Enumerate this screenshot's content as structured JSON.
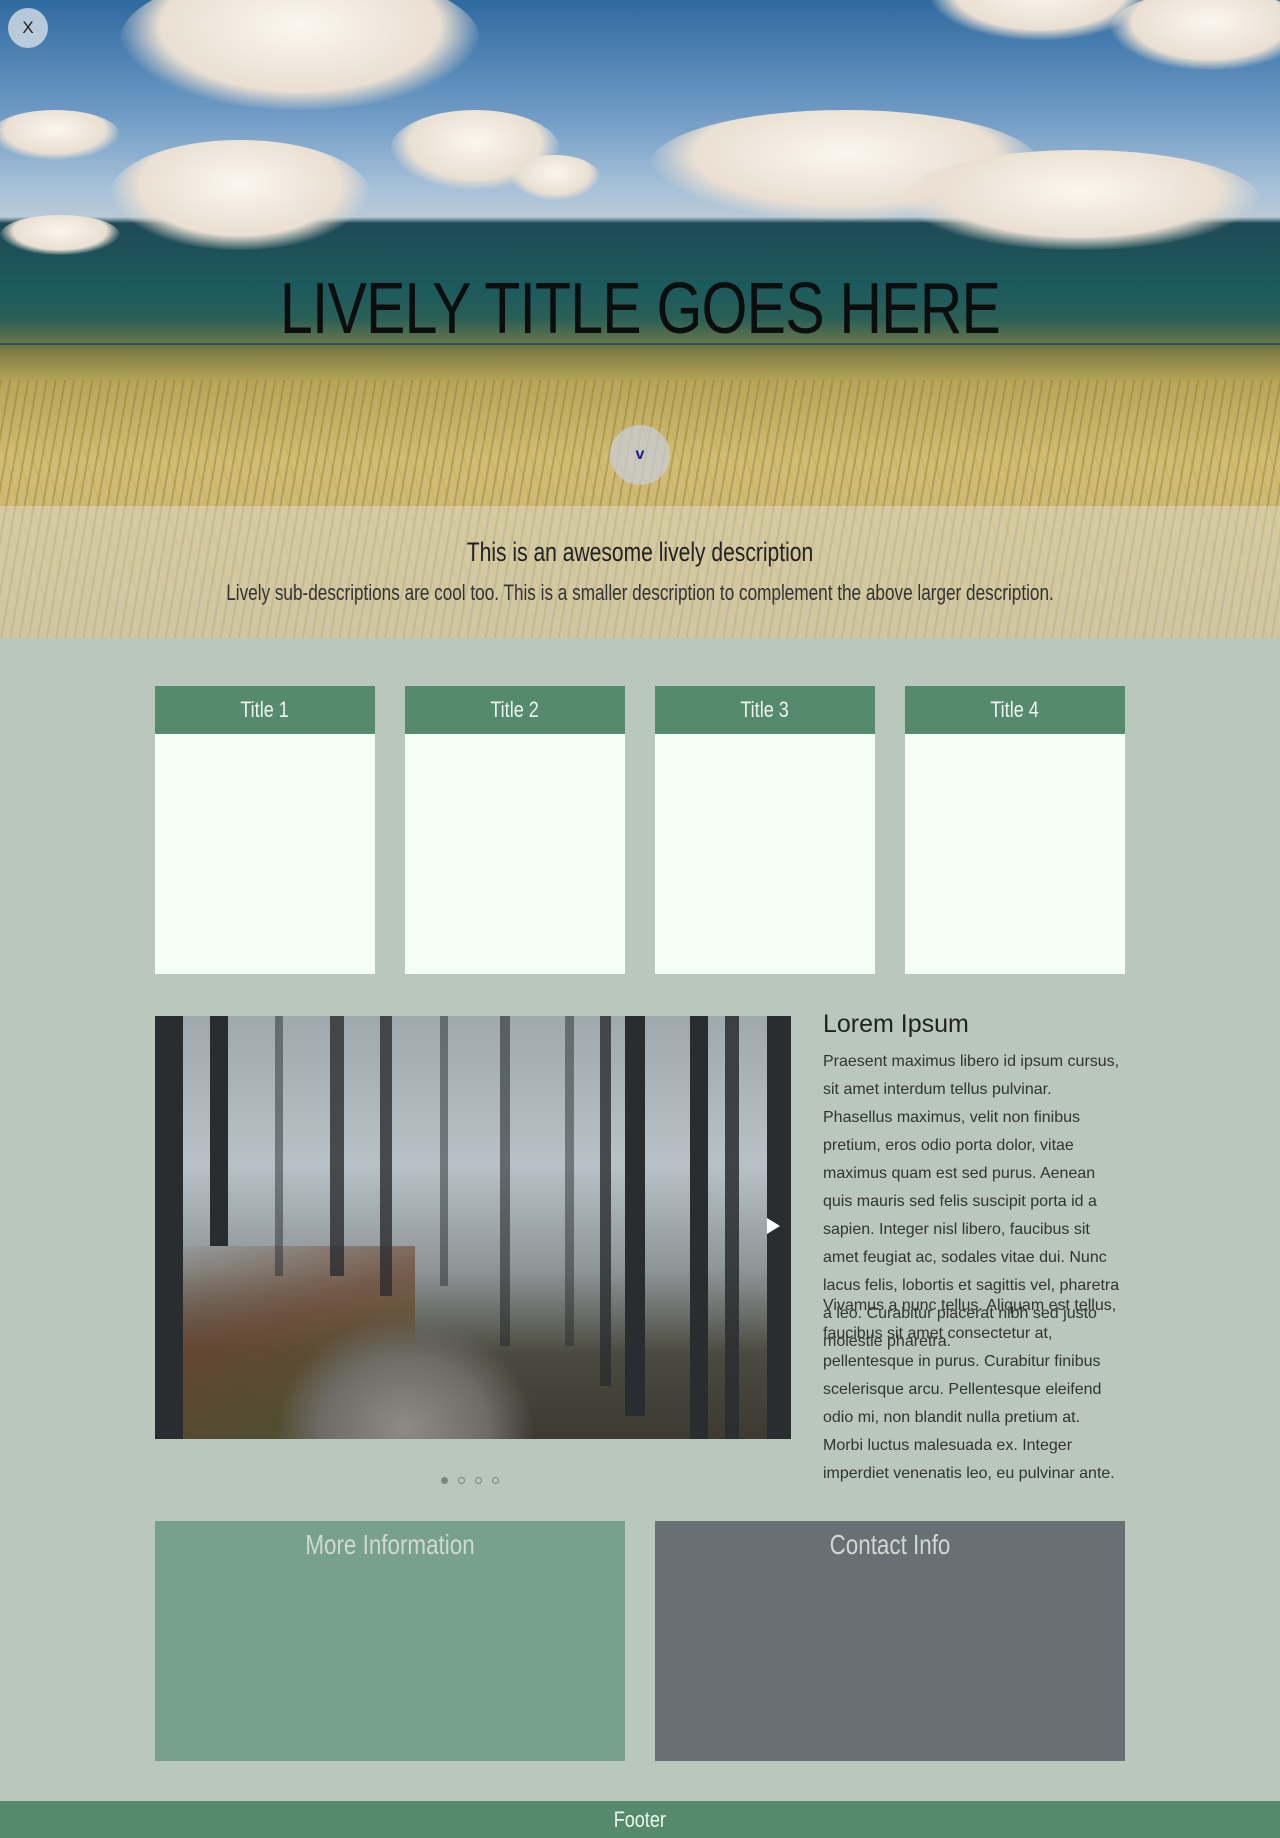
{
  "hero": {
    "close_label": "X",
    "title": "LIVELY TITLE GOES HERE",
    "scroll_label": "v",
    "description": "This is an awesome lively description",
    "sub_description": "Lively sub-descriptions are cool too. This is a smaller description to complement the above larger description."
  },
  "cards": [
    {
      "title": "Title 1"
    },
    {
      "title": "Title 2"
    },
    {
      "title": "Title 3"
    },
    {
      "title": "Title 4"
    }
  ],
  "article": {
    "title": "Lorem Ipsum",
    "paragraph1": "Praesent maximus libero id ipsum cursus, sit amet interdum tellus pulvinar. Phasellus maximus, velit non finibus pretium, eros odio porta dolor, vitae maximus quam est sed purus. Aenean quis mauris sed felis suscipit porta id a sapien. Integer nisl libero, faucibus sit amet feugiat ac, sodales vitae dui. Nunc lacus felis, lobortis et sagittis vel, pharetra a leo. Curabitur placerat nibh sed justo molestie pharetra.",
    "paragraph2": "Vivamus a nunc tellus. Aliquam est tellus, faucibus sit amet consectetur at, pellentesque in purus. Curabitur finibus scelerisque arcu. Pellentesque eleifend odio mi, non blandit nulla pretium at. Morbi luctus malesuada ex. Integer imperdiet venenatis leo, eu pulvinar ante."
  },
  "carousel": {
    "slide_count": 4,
    "active_index": 0
  },
  "info_boxes": [
    {
      "title": "More Information",
      "color": "#78a18c"
    },
    {
      "title": "Contact Info",
      "color": "#687074"
    }
  ],
  "footer": {
    "label": "Footer",
    "color": "#558a6d"
  },
  "colors": {
    "page_background": "#bac7bd",
    "card_header": "#558a6d",
    "card_body": "#f6fff6"
  }
}
